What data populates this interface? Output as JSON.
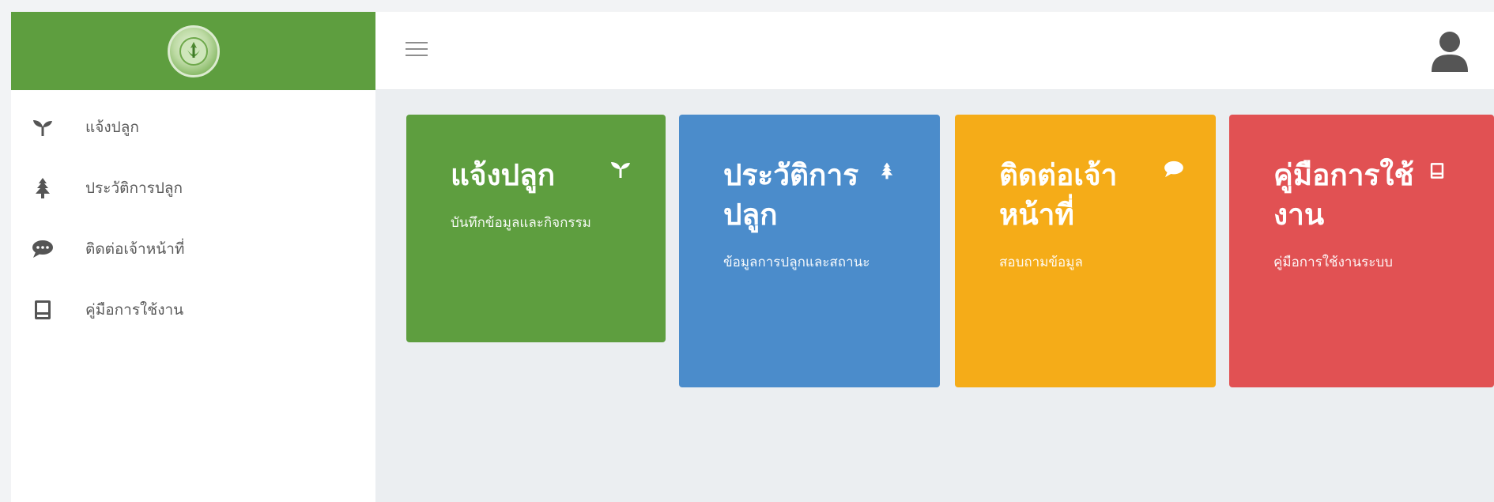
{
  "sidebar": {
    "items": [
      {
        "label": "แจ้งปลูก",
        "icon": "seedling-icon"
      },
      {
        "label": "ประวัติการปลูก",
        "icon": "tree-icon"
      },
      {
        "label": "ติดต่อเจ้าหน้าที่",
        "icon": "chat-icon"
      },
      {
        "label": "คู่มือการใช้งาน",
        "icon": "book-icon"
      }
    ]
  },
  "topbar": {
    "menu_icon": "hamburger-icon",
    "user_icon": "user-icon"
  },
  "cards": [
    {
      "title": "แจ้งปลูก",
      "subtitle": "บันทึกข้อมูลและกิจกรรม",
      "icon": "seedling-icon",
      "color": "#5e9e3f"
    },
    {
      "title": "ประวัติการปลูก",
      "subtitle": "ข้อมูลการปลูกและสถานะ",
      "icon": "tree-icon",
      "color": "#4b8ccb"
    },
    {
      "title": "ติดต่อเจ้าหน้าที่",
      "subtitle": "สอบถามข้อมูล",
      "icon": "chat-icon",
      "color": "#f5ac18"
    },
    {
      "title": "คู่มือการใช้งาน",
      "subtitle": "คู่มือการใช้งานระบบ",
      "icon": "book-icon",
      "color": "#e15153"
    }
  ],
  "colors": {
    "brand_green": "#5e9e3f",
    "blue": "#4b8ccb",
    "amber": "#f5ac18",
    "red": "#e15153",
    "background": "#ebeef1"
  }
}
